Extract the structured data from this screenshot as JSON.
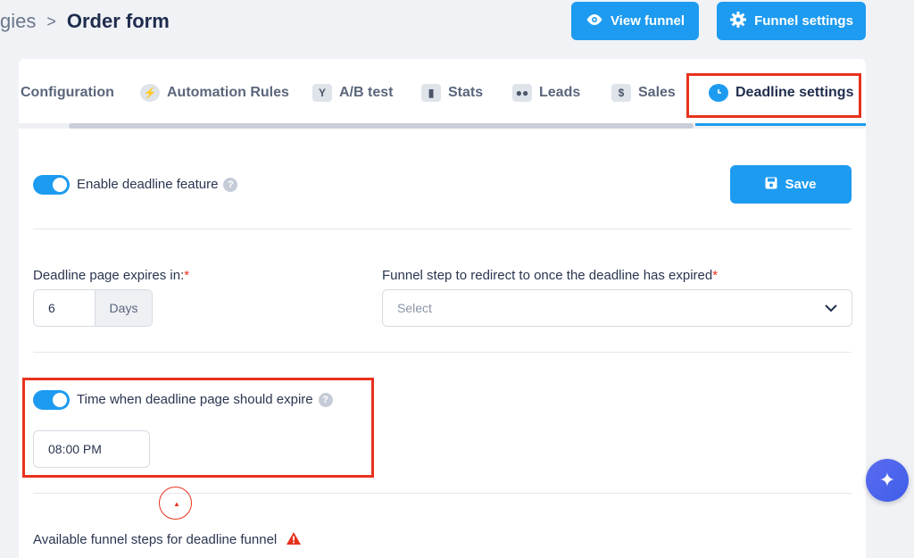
{
  "breadcrumb": {
    "previous": "gies",
    "separator": ">",
    "current": "Order form"
  },
  "header": {
    "view_funnel_label": "View funnel",
    "funnel_settings_label": "Funnel settings"
  },
  "tabs": [
    {
      "label": "Configuration",
      "icon": "none"
    },
    {
      "label": "Automation Rules",
      "icon": "bolt-icon"
    },
    {
      "label": "A/B test",
      "icon": "split-icon"
    },
    {
      "label": "Stats",
      "icon": "bar-chart-icon"
    },
    {
      "label": "Leads",
      "icon": "users-icon"
    },
    {
      "label": "Sales",
      "icon": "dollar-icon"
    },
    {
      "label": "Deadline settings",
      "icon": "clock-icon",
      "active": true
    }
  ],
  "deadline": {
    "enable_label": "Enable deadline feature",
    "enable_on": true,
    "save_label": "Save",
    "expires_label": "Deadline page expires in:",
    "required_mark": "*",
    "expires_value": "6",
    "expires_unit": "Days",
    "redirect_label": "Funnel step to redirect to once the deadline has expired",
    "redirect_placeholder": "Select",
    "time_label": "Time when deadline page should expire",
    "time_on": true,
    "time_value": "08:00 PM",
    "available_steps_label": "Available funnel steps for deadline funnel"
  },
  "help_glyph": "?",
  "colors": {
    "accent": "#1d9bf0",
    "highlight": "#e8321e",
    "background": "#f0f2f6"
  }
}
